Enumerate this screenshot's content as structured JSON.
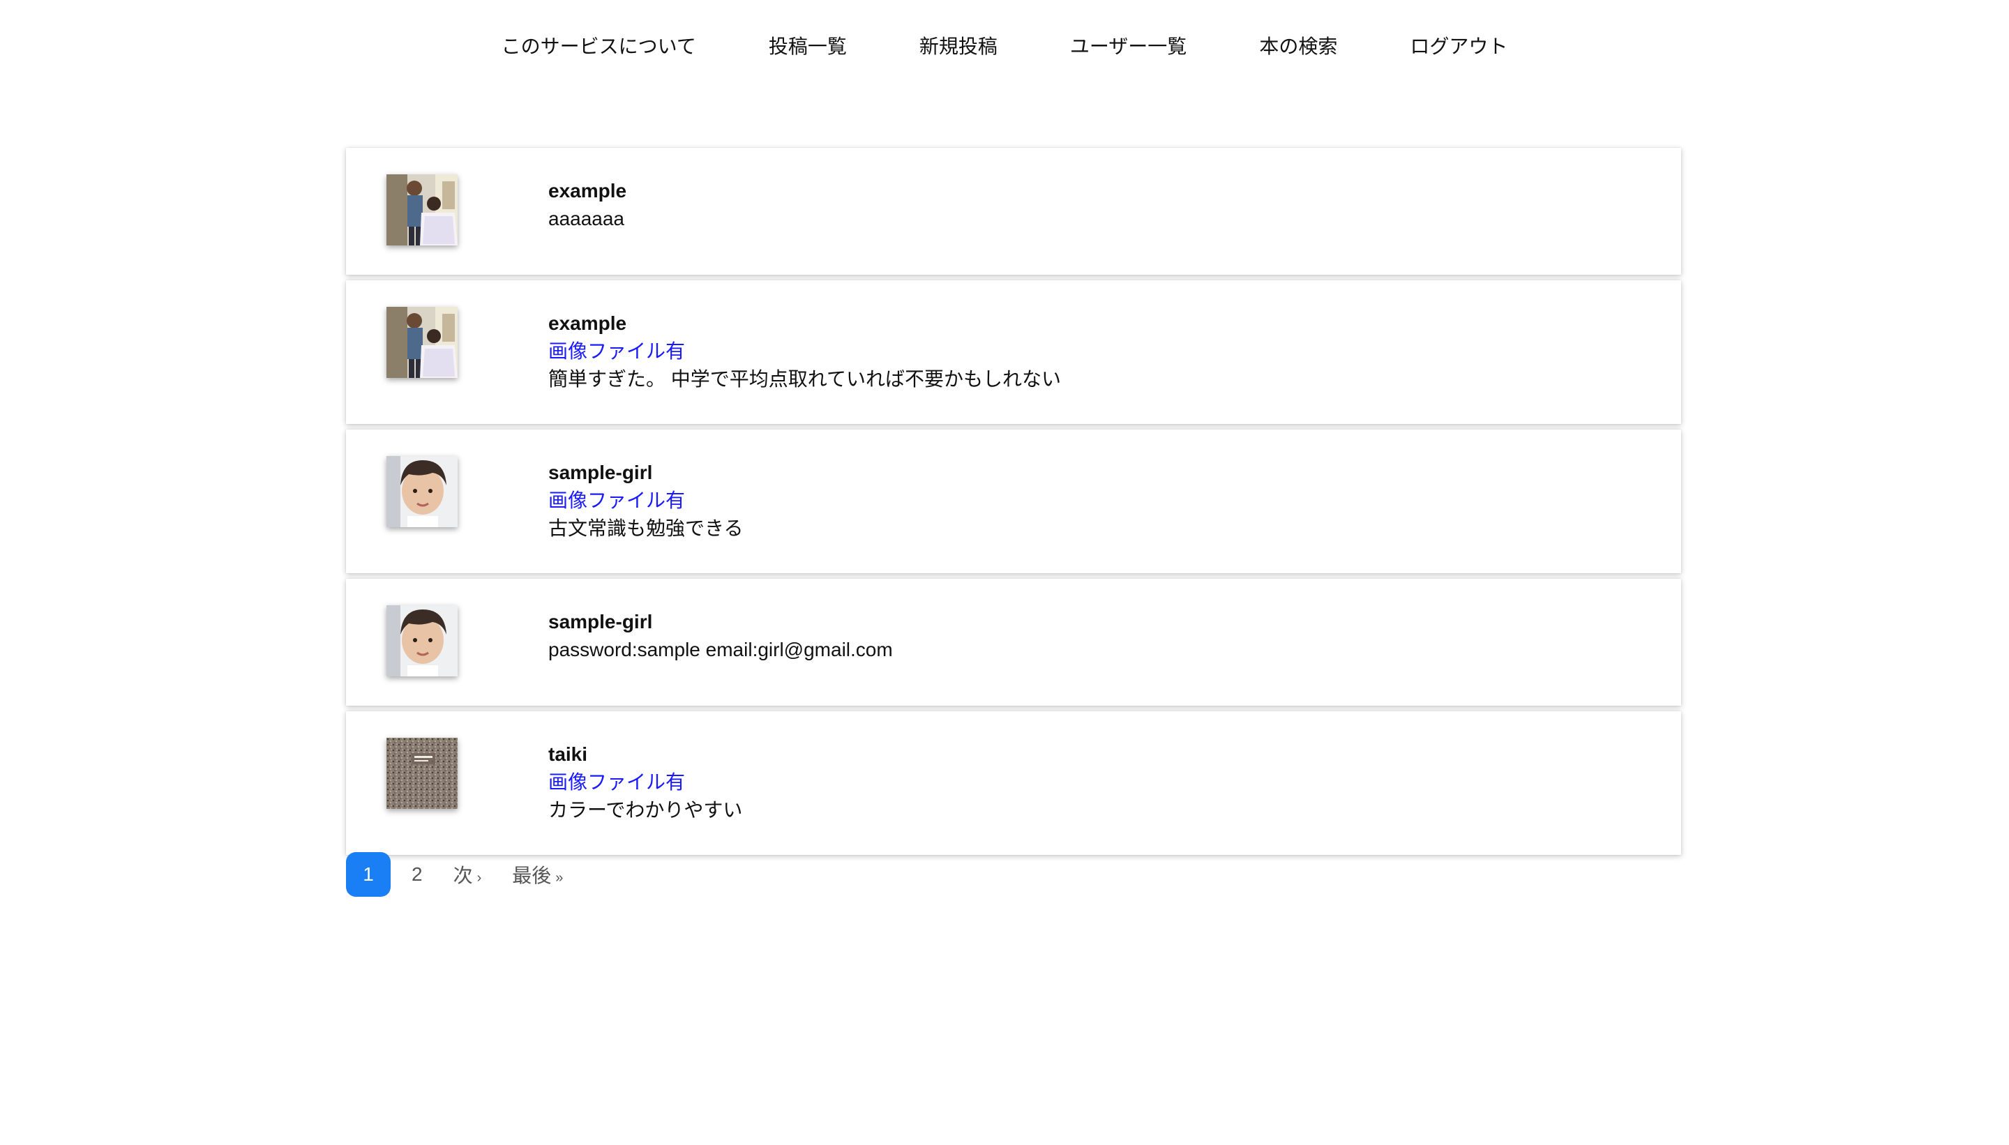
{
  "nav": {
    "items": [
      {
        "label": "このサービスについて"
      },
      {
        "label": "投稿一覧"
      },
      {
        "label": "新規投稿"
      },
      {
        "label": "ユーザー一覧"
      },
      {
        "label": "本の検索"
      },
      {
        "label": "ログアウト"
      }
    ]
  },
  "posts": [
    {
      "user": "example",
      "image_link": "",
      "content": "aaaaaaa",
      "avatar": "barber-photo"
    },
    {
      "user": "example",
      "image_link": "画像ファイル有",
      "content": "簡単すぎた。 中学で平均点取れていれば不要かもしれない",
      "avatar": "barber-photo"
    },
    {
      "user": "sample-girl",
      "image_link": "画像ファイル有",
      "content": "古文常識も勉強できる",
      "avatar": "portrait-photo"
    },
    {
      "user": "sample-girl",
      "image_link": "",
      "content": "password:sample email:girl@gmail.com",
      "avatar": "portrait-photo"
    },
    {
      "user": "taiki",
      "image_link": "画像ファイル有",
      "content": "カラーでわかりやすい",
      "avatar": "book-cover-photo"
    }
  ],
  "pagination": {
    "current": "1",
    "page2": "2",
    "next": "次",
    "next_icon": "›",
    "last": "最後",
    "last_icon": "»"
  },
  "colors": {
    "link": "#1a1aff",
    "pagination_active": "#1a7ef5"
  }
}
